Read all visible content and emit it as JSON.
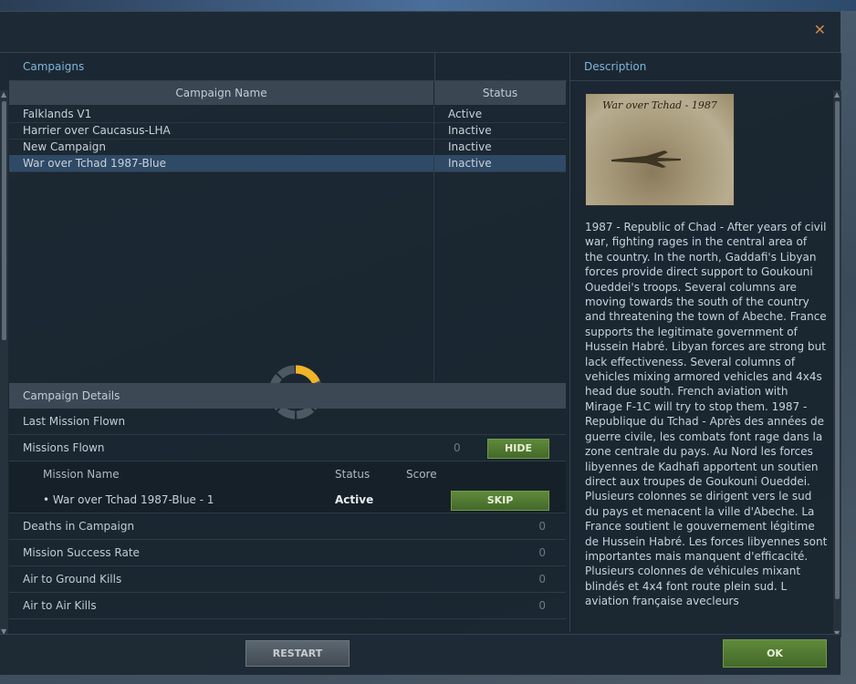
{
  "window": {
    "close_glyph": "✕"
  },
  "campaigns": {
    "title": "Campaigns",
    "columns": {
      "name": "Campaign Name",
      "status": "Status"
    },
    "rows": [
      {
        "name": "Falklands V1",
        "status": "Active"
      },
      {
        "name": "Harrier over Caucasus-LHA",
        "status": "Inactive"
      },
      {
        "name": "New Campaign",
        "status": "Inactive"
      },
      {
        "name": "War over Tchad 1987-Blue",
        "status": "Inactive",
        "selected": true
      }
    ]
  },
  "details": {
    "title": "Campaign Details",
    "last_mission_flown": "Last Mission Flown",
    "missions_flown": {
      "label": "Missions Flown",
      "count": "0",
      "hide_label": "HIDE"
    },
    "mission_table": {
      "columns": {
        "name": "Mission Name",
        "status": "Status",
        "score": "Score"
      },
      "rows": [
        {
          "name": "• War over Tchad 1987-Blue - 1",
          "status": "Active",
          "action": "SKIP"
        }
      ]
    },
    "stats": [
      {
        "label": "Deaths in Campaign",
        "value": "0"
      },
      {
        "label": "Mission Success Rate",
        "value": "0"
      },
      {
        "label": "Air to Ground Kills",
        "value": "0"
      },
      {
        "label": "Air to Air Kills",
        "value": "0"
      }
    ]
  },
  "description": {
    "title": "Description",
    "image_caption": "War over Tchad - 1987",
    "text": "1987 - Republic of Chad - After years of civil war, fighting rages in the central area of the country. In the north, Gaddafi's Libyan forces provide direct support to Goukouni Oueddei's troops. Several columns are moving towards the south of the country and threatening the town of Abeche. France supports the legitimate government of Hussein Habré. Libyan forces are strong but lack effectiveness. Several columns of vehicles mixing armored vehicles and 4x4s head due south. French aviation with Mirage F-1C will try to stop them. 1987 - Republique du Tchad - Après des années de guerre civile, les combats font rage dans la zone centrale du pays. Au Nord les forces libyennes de Kadhafi apportent un soutien direct aux troupes de Goukouni Oueddei. Plusieurs colonnes se dirigent vers le sud du pays et menacent la ville d'Abeche. La France soutient le gouvernement légitime de Hussein Habré. Les forces libyennes sont importantes mais manquent d'efficacité. Plusieurs colonnes de véhicules mixant blindés et 4x4 font route plein sud. L aviation française avecleurs"
  },
  "footer": {
    "restart_label": "RESTART",
    "ok_label": "OK"
  },
  "colors": {
    "accent": "#7fb6d8",
    "green_button": "#5f8a3a",
    "spinner": "#f0b429",
    "selected_row": "#2f4a66"
  }
}
